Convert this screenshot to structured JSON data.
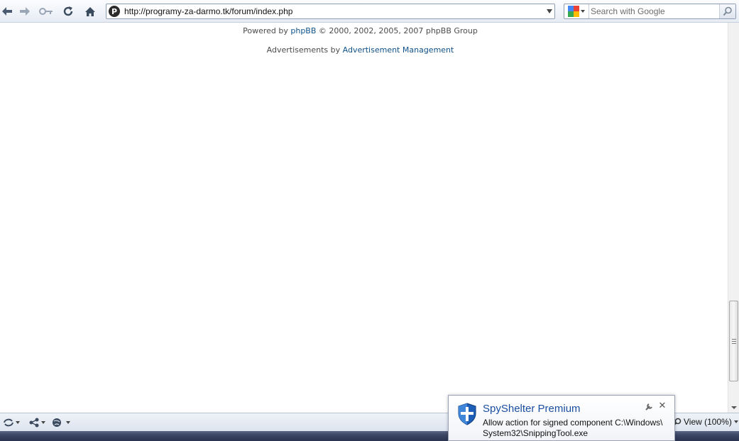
{
  "toolbar": {
    "back_icon": "back-arrow-icon",
    "forward_icon": "forward-arrow-icon",
    "key_icon": "key-icon",
    "reload_icon": "reload-icon",
    "home_icon": "home-icon",
    "url": "http://programy-za-darmo.tk/forum/index.php",
    "site_icon_letter": "P"
  },
  "search": {
    "placeholder": "Search with Google",
    "engine_icon": "google-icon"
  },
  "page": {
    "powered_prefix": "Powered by",
    "powered_link": "phpBB",
    "powered_suffix": "© 2000, 2002, 2005, 2007 phpBB Group",
    "ads_prefix": "Advertisements by",
    "ads_link": "Advertisement Management",
    "link_color": "#105289"
  },
  "statusbar": {
    "zoom_label": "View (100%)"
  },
  "notification": {
    "title": "SpyShelter Premium",
    "message": "Allow action for signed component C:\\Windows\\ System32\\SnippingTool.exe",
    "close_glyph": "✕",
    "title_color": "#1c4fa1"
  }
}
